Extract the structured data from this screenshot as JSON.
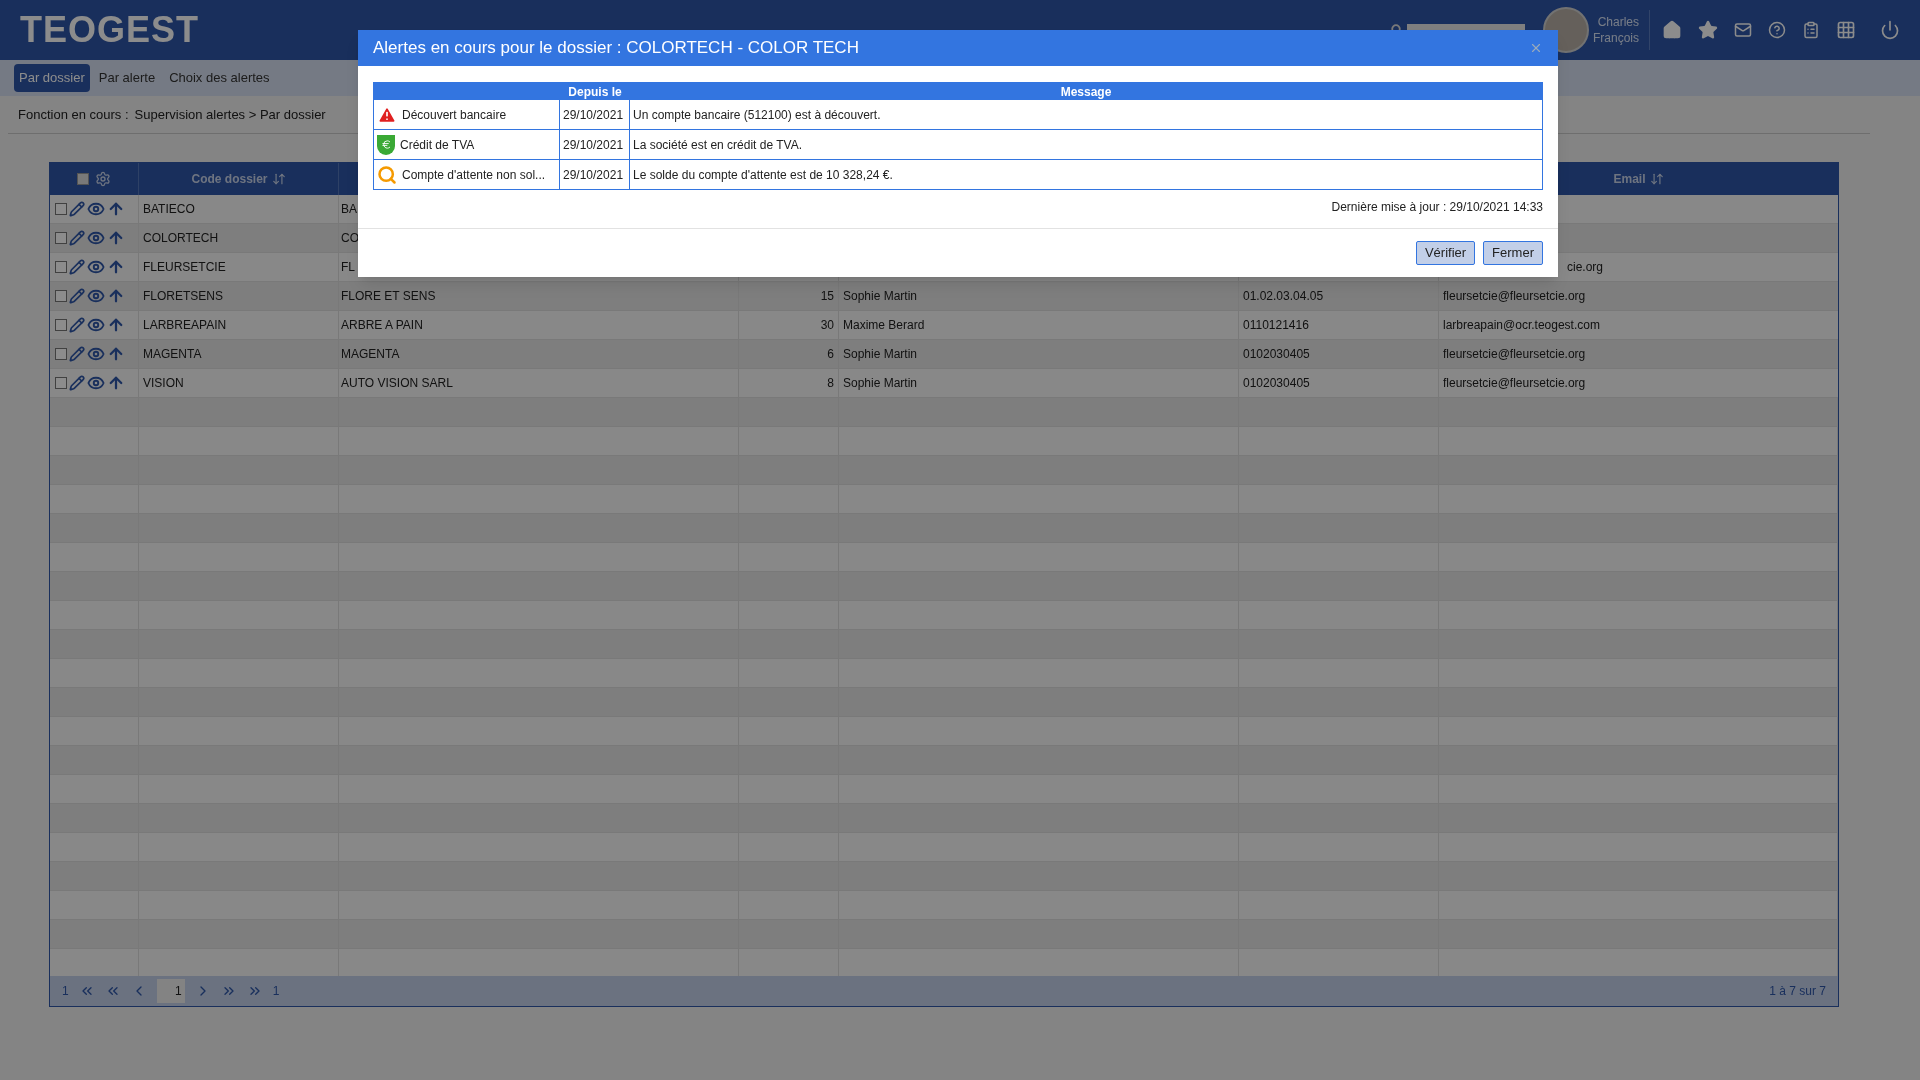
{
  "header": {
    "logo": "TEOGEST",
    "user": {
      "first_name": "Charles",
      "last_name": "François"
    }
  },
  "tabs": [
    {
      "label": "Par dossier",
      "selected": true
    },
    {
      "label": "Par alerte",
      "selected": false
    },
    {
      "label": "Choix des alertes",
      "selected": false
    }
  ],
  "breadcrumb": {
    "label": "Fonction en cours :",
    "path": "Supervision alertes > Par dossier"
  },
  "table": {
    "select_all": {
      "checked": false
    },
    "columns": [
      {
        "label": "Code dossier"
      },
      {
        "label": "Email"
      }
    ],
    "rows": [
      {
        "checked": false,
        "code": "BATIECO",
        "name": "BA"
      },
      {
        "checked": false,
        "code": "COLORTECH",
        "name": "CO"
      },
      {
        "checked": false,
        "code": "FLEURSETCIE",
        "name": "FL",
        "email": "cie.org"
      },
      {
        "checked": false,
        "code": "FLORETSENS",
        "name": "FLORE ET SENS",
        "count": "15",
        "contact": "Sophie Martin",
        "phone": "01.02.03.04.05",
        "email": "fleursetcie@fleursetcie.org"
      },
      {
        "checked": false,
        "code": "LARBREAPAIN",
        "name": "ARBRE A PAIN",
        "count": "30",
        "contact": "Maxime Berard",
        "phone": "0110121416",
        "email": "larbreapain@ocr.teogest.com"
      },
      {
        "checked": false,
        "code": "MAGENTA",
        "name": "MAGENTA",
        "count": "6",
        "contact": "Sophie Martin",
        "phone": "0102030405",
        "email": "fleursetcie@fleursetcie.org"
      },
      {
        "checked": false,
        "code": "VISION",
        "name": "AUTO VISION SARL",
        "count": "8",
        "contact": "Sophie Martin",
        "phone": "0102030405",
        "email": "fleursetcie@fleursetcie.org"
      }
    ]
  },
  "pagination": {
    "first_page": "1",
    "current_page": "1",
    "last_page": "1",
    "summary": "1 à 7 sur 7"
  },
  "dialog": {
    "title": "Alertes en cours pour le dossier : COLORTECH - COLOR TECH",
    "columns": [
      "Depuis le",
      "Message"
    ],
    "alerts": [
      {
        "kind": "warning",
        "label": "Découvert bancaire",
        "date": "29/10/2021",
        "message": "Un compte bancaire (512100) est à découvert."
      },
      {
        "kind": "money",
        "label": "Crédit de TVA",
        "date": "29/10/2021",
        "message": "La société est en crédit de TVA."
      },
      {
        "kind": "search",
        "label": "Compte d'attente non sol...",
        "date": "29/10/2021",
        "message": "Le solde du compte d'attente est de 10 328,24 €."
      }
    ],
    "updated": "Dernière mise à jour : 29/10/2021 14:33",
    "buttons": [
      "Vérifier",
      "Fermer"
    ]
  }
}
